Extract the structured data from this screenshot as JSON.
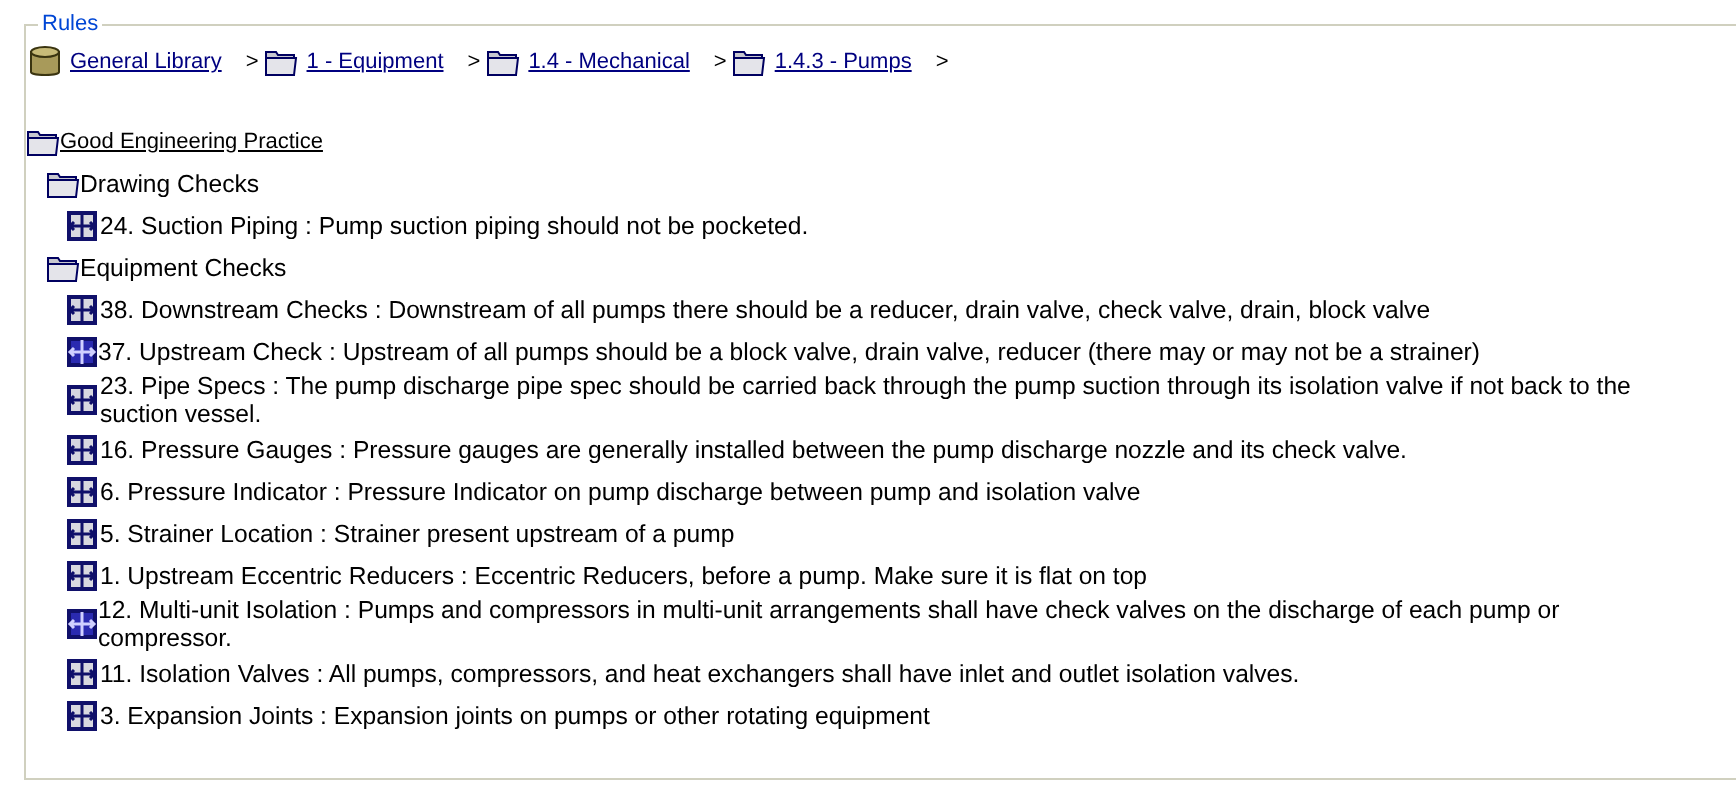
{
  "group_title": "Rules",
  "breadcrumb": [
    {
      "label": "General Library",
      "kind": "library",
      "separator": ">"
    },
    {
      "label": "1 - Equipment",
      "kind": "folder",
      "separator": ">"
    },
    {
      "label": "1.4 - Mechanical",
      "kind": "folder",
      "separator": ">"
    },
    {
      "label": "1.4.3 - Pumps",
      "kind": "folder",
      "separator": ">"
    }
  ],
  "tree": {
    "label": "Good Engineering Practice",
    "kind": "folder",
    "children": [
      {
        "label": "Drawing Checks",
        "kind": "folder",
        "children": [
          {
            "label": "24. Suction Piping : Pump suction piping should not be pocketed.",
            "kind": "rule"
          }
        ]
      },
      {
        "label": "Equipment Checks",
        "kind": "folder",
        "children": [
          {
            "label": "38. Downstream Checks : Downstream of all pumps there should be a reducer, drain valve, check valve, drain, block valve",
            "kind": "rule"
          },
          {
            "label": "37. Upstream Check : Upstream of all pumps should be a block valve, drain valve, reducer (there may or may not be a strainer)",
            "kind": "rule-filled"
          },
          {
            "label": "23. Pipe Specs : The pump discharge pipe spec should be carried back through the pump suction through its isolation valve if not back to the suction vessel.",
            "kind": "rule"
          },
          {
            "label": "16. Pressure Gauges : Pressure gauges are generally installed between the pump discharge nozzle and its check valve.",
            "kind": "rule"
          },
          {
            "label": "6. Pressure Indicator : Pressure Indicator on pump discharge between pump and isolation valve",
            "kind": "rule"
          },
          {
            "label": "5. Strainer Location : Strainer present upstream of a pump",
            "kind": "rule"
          },
          {
            "label": "1. Upstream Eccentric Reducers : Eccentric Reducers, before a pump. Make sure it is flat on top",
            "kind": "rule"
          },
          {
            "label": "12. Multi-unit Isolation : Pumps and compressors in multi-unit arrangements shall have check valves on the discharge of each pump or compressor.",
            "kind": "rule-filled"
          },
          {
            "label": "11. Isolation Valves : All pumps, compressors, and heat exchangers shall have inlet and outlet isolation valves.",
            "kind": "rule"
          },
          {
            "label": "3. Expansion Joints : Expansion joints on pumps or other rotating equipment",
            "kind": "rule"
          }
        ]
      }
    ]
  }
}
